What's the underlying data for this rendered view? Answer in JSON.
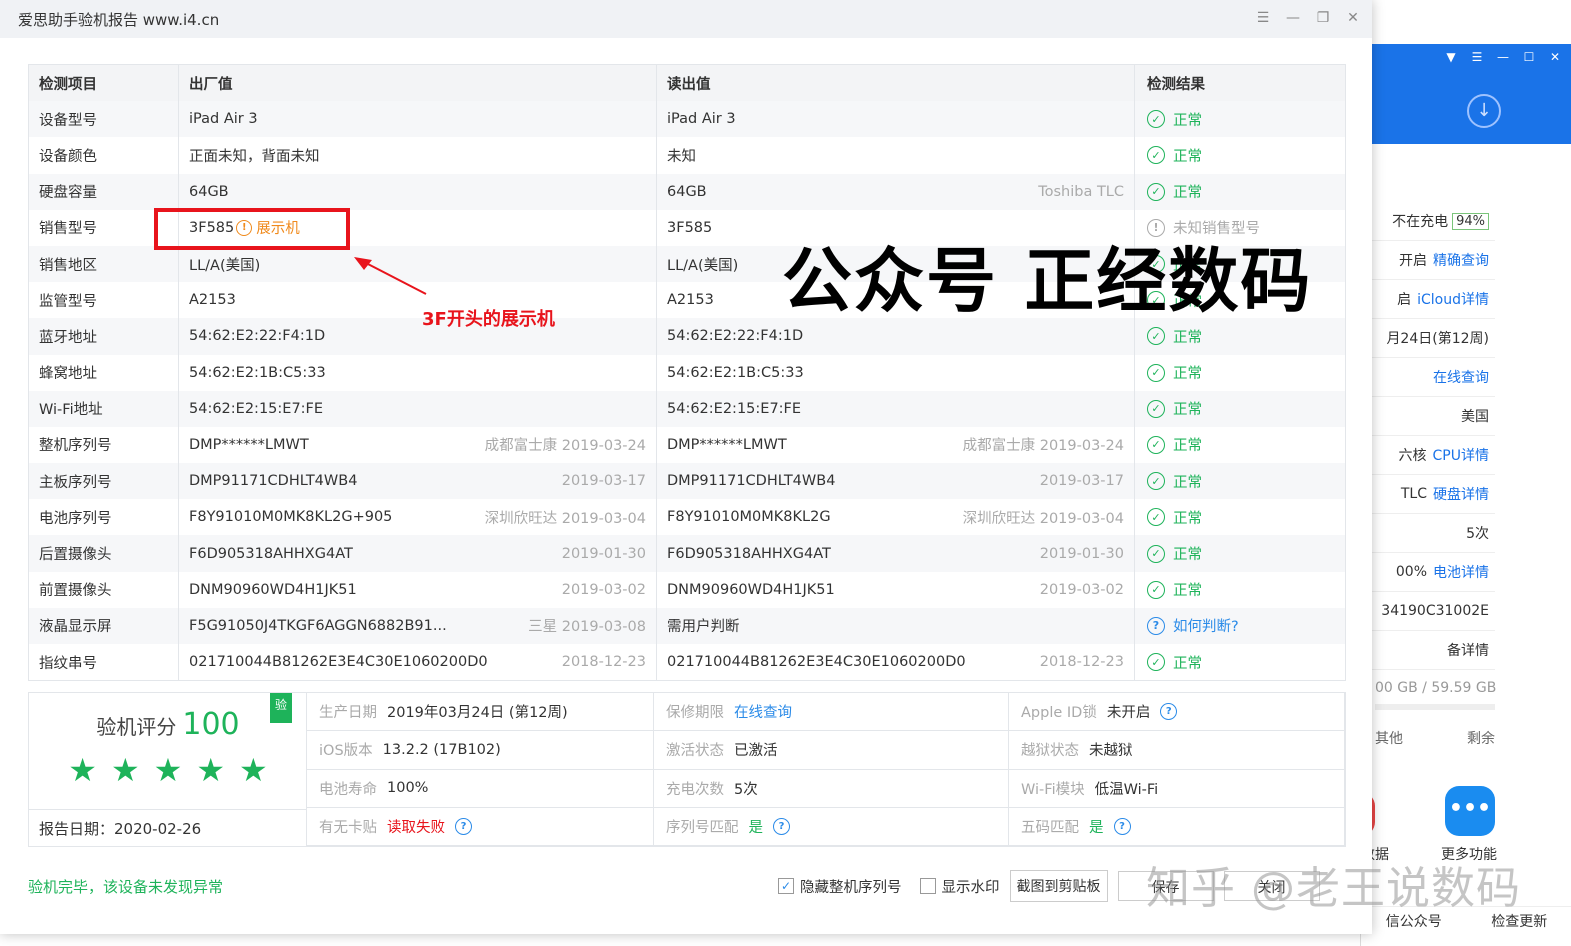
{
  "window": {
    "title": "爱思助手验机报告 www.i4.cn",
    "controls": [
      "menu-icon",
      "minimize-icon",
      "restore-icon",
      "close-icon"
    ]
  },
  "table": {
    "headers": [
      "检测项目",
      "出厂值",
      "读出值",
      "检测结果"
    ],
    "rows": [
      {
        "item": "设备型号",
        "factory": "iPad Air 3",
        "factory_note": "",
        "read": "iPad Air 3",
        "read_note": "",
        "result": "正常",
        "status": "ok"
      },
      {
        "item": "设备颜色",
        "factory": "正面未知，背面未知",
        "factory_note": "",
        "read": "未知",
        "read_note": "",
        "result": "正常",
        "status": "ok"
      },
      {
        "item": "硬盘容量",
        "factory": "64GB",
        "factory_note": "",
        "read": "64GB",
        "read_note": "Toshiba TLC",
        "result": "正常",
        "status": "ok"
      },
      {
        "item": "销售型号",
        "factory": "3F585",
        "factory_note": "",
        "read": "3F585",
        "read_note": "",
        "result": "未知销售型号",
        "status": "warn",
        "badge": "展示机"
      },
      {
        "item": "销售地区",
        "factory": "LL/A(美国)",
        "factory_note": "",
        "read": "LL/A(美国)",
        "read_note": "",
        "result": "正常",
        "status": "ok"
      },
      {
        "item": "监管型号",
        "factory": "A2153",
        "factory_note": "",
        "read": "A2153",
        "read_note": "",
        "result": "正常",
        "status": "ok"
      },
      {
        "item": "蓝牙地址",
        "factory": "54:62:E2:22:F4:1D",
        "factory_note": "",
        "read": "54:62:E2:22:F4:1D",
        "read_note": "",
        "result": "正常",
        "status": "ok"
      },
      {
        "item": "蜂窝地址",
        "factory": "54:62:E2:1B:C5:33",
        "factory_note": "",
        "read": "54:62:E2:1B:C5:33",
        "read_note": "",
        "result": "正常",
        "status": "ok"
      },
      {
        "item": "Wi-Fi地址",
        "factory": "54:62:E2:15:E7:FE",
        "factory_note": "",
        "read": "54:62:E2:15:E7:FE",
        "read_note": "",
        "result": "正常",
        "status": "ok"
      },
      {
        "item": "整机序列号",
        "factory": "DMP******LMWT",
        "factory_note": "成都富士康 2019-03-24",
        "read": "DMP******LMWT",
        "read_note": "成都富士康 2019-03-24",
        "result": "正常",
        "status": "ok"
      },
      {
        "item": "主板序列号",
        "factory": "DMP91171CDHLT4WB4",
        "factory_note": "2019-03-17",
        "read": "DMP91171CDHLT4WB4",
        "read_note": "2019-03-17",
        "result": "正常",
        "status": "ok"
      },
      {
        "item": "电池序列号",
        "factory": "F8Y91010M0MK8KL2G+905",
        "factory_note": "深圳欣旺达 2019-03-04",
        "read": "F8Y91010M0MK8KL2G",
        "read_note": "深圳欣旺达 2019-03-04",
        "result": "正常",
        "status": "ok"
      },
      {
        "item": "后置摄像头",
        "factory": "F6D905318AHHXG4AT",
        "factory_note": "2019-01-30",
        "read": "F6D905318AHHXG4AT",
        "read_note": "2019-01-30",
        "result": "正常",
        "status": "ok"
      },
      {
        "item": "前置摄像头",
        "factory": "DNM90960WD4H1JK51",
        "factory_note": "2019-03-02",
        "read": "DNM90960WD4H1JK51",
        "read_note": "2019-03-02",
        "result": "正常",
        "status": "ok"
      },
      {
        "item": "液晶显示屏",
        "factory": "F5G91050J4TKGF6AGGN6882B91...",
        "factory_note": "三星 2019-03-08",
        "read": "需用户判断",
        "read_note": "",
        "result": "如何判断?",
        "status": "ask"
      },
      {
        "item": "指纹串号",
        "factory": "021710044B81262E3E4C30E1060200D0",
        "factory_note": "2018-12-23",
        "read": "021710044B81262E3E4C30E1060200D0",
        "read_note": "2018-12-23",
        "result": "正常",
        "status": "ok"
      }
    ]
  },
  "annotation": {
    "text": "3F开头的展示机",
    "watermark": "公众号 正经数码"
  },
  "summary": {
    "score_label": "验机评分",
    "score": "100",
    "verified_tag": "验",
    "stars": 5,
    "report_date": "报告日期：2020-02-26",
    "cells": [
      {
        "k": "生产日期",
        "v": "2019年03月24日 (第12周)",
        "style": "",
        "q": false
      },
      {
        "k": "保修期限",
        "v": "在线查询",
        "style": "blue",
        "q": false
      },
      {
        "k": "Apple ID锁",
        "v": "未开启",
        "style": "",
        "q": true
      },
      {
        "k": "iOS版本",
        "v": "13.2.2 (17B102)",
        "style": "",
        "q": false
      },
      {
        "k": "激活状态",
        "v": "已激活",
        "style": "",
        "q": false
      },
      {
        "k": "越狱状态",
        "v": "未越狱",
        "style": "",
        "q": false
      },
      {
        "k": "电池寿命",
        "v": "100%",
        "style": "",
        "q": false
      },
      {
        "k": "充电次数",
        "v": "5次",
        "style": "",
        "q": false
      },
      {
        "k": "Wi-Fi模块",
        "v": "低温Wi-Fi",
        "style": "",
        "q": false
      },
      {
        "k": "有无卡贴",
        "v": "读取失败",
        "style": "red",
        "q": true
      },
      {
        "k": "序列号匹配",
        "v": "是",
        "style": "green",
        "q": true
      },
      {
        "k": "五码匹配",
        "v": "是",
        "style": "green",
        "q": true
      }
    ]
  },
  "bottom": {
    "status": "验机完毕，该设备未发现异常",
    "hide_serial_label": "隐藏整机序列号",
    "hide_serial_checked": true,
    "watermark_label": "显示水印",
    "watermark_checked": false,
    "copy_button": "截图到剪贴板",
    "save_button": "保存",
    "close_button": "关闭",
    "zhihu_watermark": "知乎 @老王说数码"
  },
  "background_app": {
    "rows": [
      {
        "a": "不在充电",
        "b": "94%",
        "kind": "badge"
      },
      {
        "a": "开启",
        "b": "精确查询",
        "kind": "link"
      },
      {
        "a": "启",
        "b": "iCloud详情",
        "kind": "link"
      },
      {
        "a": "月24日(第12周)",
        "b": "",
        "kind": "text"
      },
      {
        "a": "",
        "b": "在线查询",
        "kind": "link"
      },
      {
        "a": "美国",
        "b": "",
        "kind": "text"
      },
      {
        "a": "六核",
        "b": "CPU详情",
        "kind": "link"
      },
      {
        "a": "TLC",
        "b": "硬盘详情",
        "kind": "link"
      },
      {
        "a": "5次",
        "b": "",
        "kind": "text"
      },
      {
        "a": "00%",
        "b": "电池详情",
        "kind": "link"
      },
      {
        "a": "34190C31002E",
        "b": "",
        "kind": "text"
      },
      {
        "a": "备详情",
        "b": "",
        "kind": "text"
      }
    ],
    "storage": "00 GB / 59.59 GB",
    "legend_other": "其他",
    "legend_free": "剩余",
    "data_label": "数据",
    "more_label": "更多功能",
    "footer_left": "信公众号",
    "footer_right": "检查更新"
  },
  "colors": {
    "ok": "#1eb35a",
    "warn": "#aaaaaa",
    "link": "#2b8be8",
    "highlight": "#e8141c",
    "demo": "#f08a1c"
  }
}
